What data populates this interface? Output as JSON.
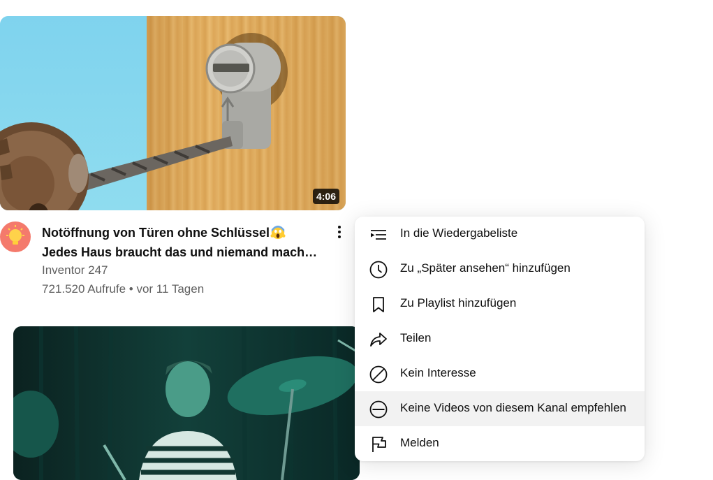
{
  "video1": {
    "duration": "4:06",
    "title_line1": "Notöffnung von Türen ohne Schlüssel",
    "title_emoji": "face-screaming-in-fear-emoji",
    "title_line2": "Jedes Haus braucht das und niemand mach…",
    "channel": "Inventor 247",
    "stats": "721.520 Aufrufe • vor 11 Tagen",
    "avatar_color": "#f47a6c"
  },
  "menu": {
    "items": [
      {
        "label": "In die Wiedergabeliste",
        "icon": "add-to-queue-icon"
      },
      {
        "label": "Zu „Später ansehen“ hinzufügen",
        "icon": "clock-icon"
      },
      {
        "label": "Zu Playlist hinzufügen",
        "icon": "bookmark-icon"
      },
      {
        "label": "Teilen",
        "icon": "share-icon"
      },
      {
        "label": "Kein Interesse",
        "icon": "not-interested-icon"
      },
      {
        "label": "Keine Videos von diesem Kanal empfehlen",
        "icon": "minus-circle-icon",
        "highlighted": true
      },
      {
        "label": "Melden",
        "icon": "flag-icon"
      }
    ]
  },
  "colors": {
    "text_primary": "#0f0f0f",
    "text_secondary": "#606060",
    "menu_hover": "#f2f2f2"
  }
}
